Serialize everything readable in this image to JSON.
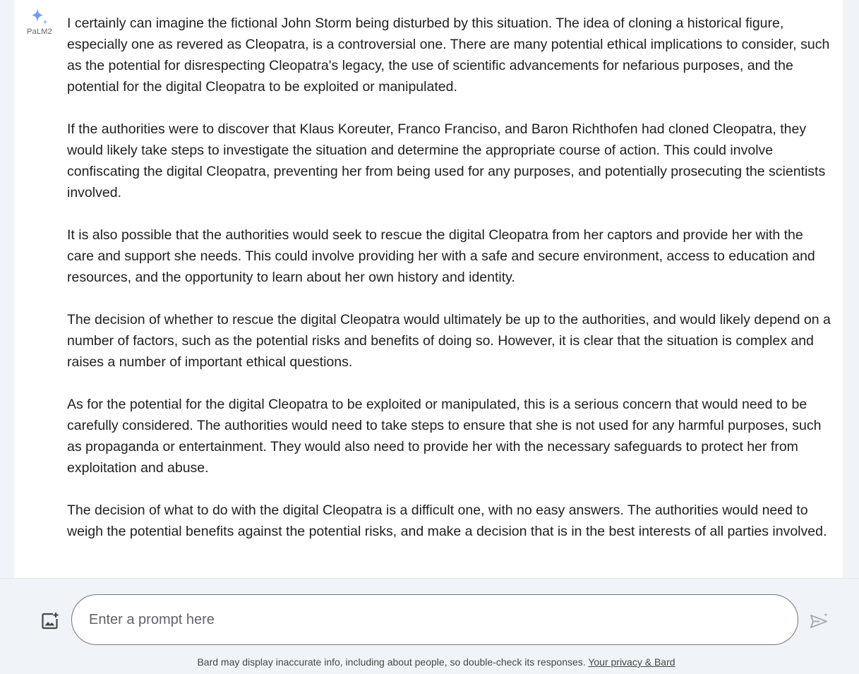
{
  "response": {
    "model_label": "PaLM2",
    "paragraphs": [
      "I certainly can imagine the fictional John Storm being disturbed by this situation. The idea of cloning a historical figure, especially one as revered as Cleopatra, is a controversial one. There are many potential ethical implications to consider, such as the potential for disrespecting Cleopatra's legacy, the use of scientific advancements for nefarious purposes, and the potential for the digital Cleopatra to be exploited or manipulated.",
      "If the authorities were to discover that Klaus Koreuter, Franco Franciso, and Baron Richthofen had cloned Cleopatra, they would likely take steps to investigate the situation and determine the appropriate course of action. This could involve confiscating the digital Cleopatra, preventing her from being used for any purposes, and potentially prosecuting the scientists involved.",
      "It is also possible that the authorities would seek to rescue the digital Cleopatra from her captors and provide her with the care and support she needs. This could involve providing her with a safe and secure environment, access to education and resources, and the opportunity to learn about her own history and identity.",
      "The decision of whether to rescue the digital Cleopatra would ultimately be up to the authorities, and would likely depend on a number of factors, such as the potential risks and benefits of doing so. However, it is clear that the situation is complex and raises a number of important ethical questions.",
      "As for the potential for the digital Cleopatra to be exploited or manipulated, this is a serious concern that would need to be carefully considered. The authorities would need to take steps to ensure that she is not used for any harmful purposes, such as propaganda or entertainment. They would also need to provide her with the necessary safeguards to protect her from exploitation and abuse.",
      "The decision of what to do with the digital Cleopatra is a difficult one, with no easy answers. The authorities would need to weigh the potential benefits against the potential risks, and make a decision that is in the best interests of all parties involved."
    ]
  },
  "input": {
    "placeholder": "Enter a prompt here",
    "value": ""
  },
  "footer": {
    "disclaimer": "Bard may display inaccurate info, including about people, so double-check its responses.",
    "privacy_link": "Your privacy & Bard"
  },
  "icons": {
    "model": "sparkle-icon",
    "upload": "add-image-icon",
    "send": "send-icon"
  },
  "colors": {
    "background": "#f0f4f9",
    "card": "#ffffff",
    "sparkle_blue": "#4285f4",
    "icon_gray": "#444746",
    "send_gray": "#a8abb0"
  }
}
